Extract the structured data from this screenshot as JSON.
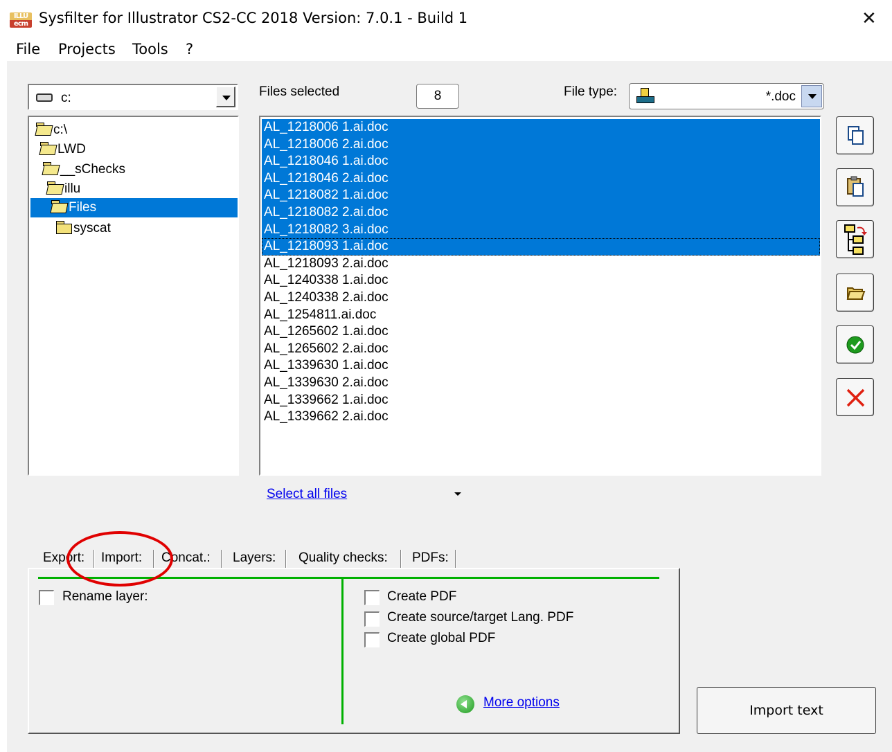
{
  "window": {
    "app_icon_text_top": "ILLU",
    "app_icon_text_bottom": "ecm",
    "title": "Sysfilter for Illustrator CS2-CC 2018 Version: 7.0.1 - Build 1",
    "close_glyph": "✕"
  },
  "menu": [
    "File",
    "Projects",
    "Tools",
    "?"
  ],
  "drive": {
    "value": "c:",
    "icon": "drive-icon"
  },
  "tree": [
    {
      "label": "c:\\",
      "icon": "open-folder-icon",
      "selected": false
    },
    {
      "label": "LWD",
      "icon": "open-folder-icon",
      "selected": false
    },
    {
      "label": "__sChecks",
      "icon": "open-folder-icon",
      "selected": false
    },
    {
      "label": "illu",
      "icon": "open-folder-icon",
      "selected": false
    },
    {
      "label": "Files",
      "icon": "open-folder-icon",
      "selected": true
    },
    {
      "label": "syscat",
      "icon": "folder-icon",
      "selected": false
    }
  ],
  "files_selected_label": "Files selected",
  "files_selected_count": "8",
  "file_type": {
    "label": "File type:",
    "value": "*.doc"
  },
  "files": [
    {
      "name": "AL_1218006 1.ai.doc",
      "selected": true
    },
    {
      "name": "AL_1218006 2.ai.doc",
      "selected": true
    },
    {
      "name": "AL_1218046 1.ai.doc",
      "selected": true
    },
    {
      "name": "AL_1218046 2.ai.doc",
      "selected": true
    },
    {
      "name": "AL_1218082 1.ai.doc",
      "selected": true
    },
    {
      "name": "AL_1218082 2.ai.doc",
      "selected": true
    },
    {
      "name": "AL_1218082 3.ai.doc",
      "selected": true
    },
    {
      "name": "AL_1218093 1.ai.doc",
      "selected": true
    },
    {
      "name": "AL_1218093 2.ai.doc",
      "selected": false
    },
    {
      "name": "AL_1240338 1.ai.doc",
      "selected": false
    },
    {
      "name": "AL_1240338 2.ai.doc",
      "selected": false
    },
    {
      "name": "AL_1254811.ai.doc",
      "selected": false
    },
    {
      "name": "AL_1265602 1.ai.doc",
      "selected": false
    },
    {
      "name": "AL_1265602 2.ai.doc",
      "selected": false
    },
    {
      "name": "AL_1339630 1.ai.doc",
      "selected": false
    },
    {
      "name": "AL_1339630 2.ai.doc",
      "selected": false
    },
    {
      "name": "AL_1339662 1.ai.doc",
      "selected": false
    },
    {
      "name": "AL_1339662 2.ai.doc",
      "selected": false
    }
  ],
  "select_all_label": "Select all files",
  "side_buttons": [
    "copy-icon",
    "paste-icon",
    "folder-tree-icon",
    "open-folder-icon",
    "checkmark-icon",
    "cancel-icon"
  ],
  "tabs": [
    {
      "label": "Export:",
      "active": false
    },
    {
      "label": "Import:",
      "active": true
    },
    {
      "label": "Concat.:",
      "active": false
    },
    {
      "label": "Layers:",
      "active": false
    },
    {
      "label": "Quality checks:",
      "active": false
    },
    {
      "label": "PDFs:",
      "active": false
    }
  ],
  "import_panel": {
    "rename_layer": {
      "label": "Rename layer:",
      "checked": false
    },
    "pdf_options": [
      {
        "label": "Create PDF",
        "checked": false
      },
      {
        "label": "Create source/target Lang. PDF",
        "checked": false
      },
      {
        "label": "Create global PDF",
        "checked": false
      }
    ],
    "more_options": "More options"
  },
  "import_button": "Import text",
  "colors": {
    "selection": "#0078d7",
    "green_divider": "#00b000",
    "annotation_circle": "#e00000",
    "link": "#0000ee"
  }
}
